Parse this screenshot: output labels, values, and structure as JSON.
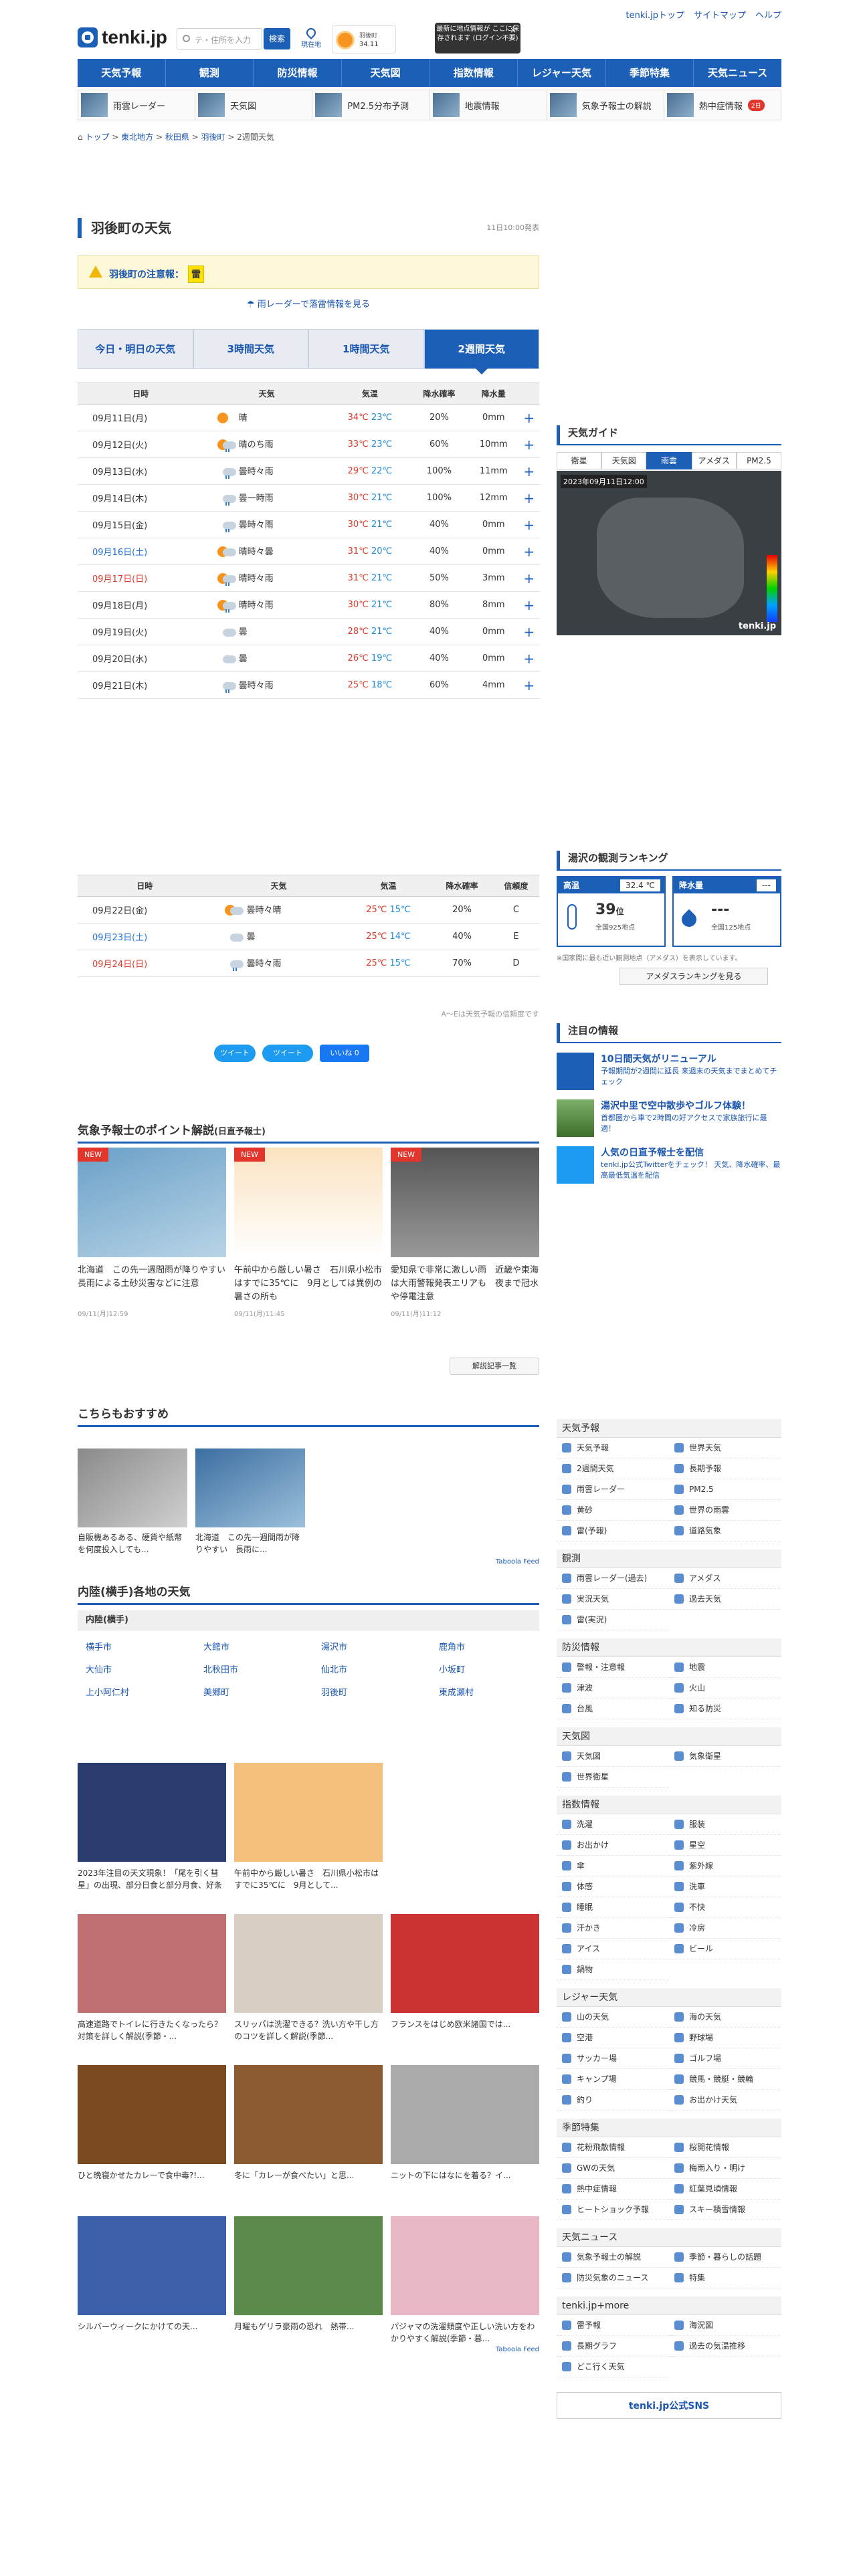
{
  "header": {
    "logo": "tenki.jp",
    "search_placeholder": "テ・住所を入力",
    "search_btn": "検索",
    "loc": "現在地",
    "home_t1": "羽後町",
    "home_t2": "34.11",
    "tooltip": "最新に地点情報が ここに保存されます (ログイン不要)",
    "close": "×",
    "toplinks": [
      "tenki.jpトップ",
      "サイトマップ",
      "ヘルプ"
    ]
  },
  "gnav": [
    "天気予報",
    "観測",
    "防災情報",
    "天気図",
    "指数情報",
    "レジャー天気",
    "季節特集",
    "天気ニュース"
  ],
  "snav": [
    {
      "label": "雨雲レーダー"
    },
    {
      "label": "天気図"
    },
    {
      "label": "PM2.5分布予測"
    },
    {
      "label": "地震情報"
    },
    {
      "label": "気象予報士の解説"
    },
    {
      "label": "熱中症情報",
      "badge": "2日"
    }
  ],
  "breadcrumb": [
    "トップ",
    "東北地方",
    "秋田県",
    "羽後町",
    "2週間天気"
  ],
  "page": {
    "title": "羽後町の天気",
    "updated": "11日10:00発表",
    "warn_label": "羽後町の注意報：",
    "warn_badge": "雷",
    "radar_link": "雨レーダーで落雷情報を見る"
  },
  "tabs": [
    "今日・明日の天気",
    "3時間天気",
    "1時間天気",
    "2週間天気"
  ],
  "table_head": [
    "日時",
    "天気",
    "気温",
    "降水確率",
    "降水量"
  ],
  "rows": [
    {
      "d": "09月11日(月)",
      "w": "晴",
      "hi": "34℃",
      "lo": "23℃",
      "p": "20%",
      "a": "0mm",
      "k": "s"
    },
    {
      "d": "09月12日(火)",
      "w": "晴のち雨",
      "hi": "33℃",
      "lo": "23℃",
      "p": "60%",
      "a": "10mm",
      "k": "sr"
    },
    {
      "d": "09月13日(水)",
      "w": "曇時々雨",
      "hi": "29℃",
      "lo": "22℃",
      "p": "100%",
      "a": "11mm",
      "k": "cr"
    },
    {
      "d": "09月14日(木)",
      "w": "曇一時雨",
      "hi": "30℃",
      "lo": "21℃",
      "p": "100%",
      "a": "12mm",
      "k": "cr"
    },
    {
      "d": "09月15日(金)",
      "w": "曇時々雨",
      "hi": "30℃",
      "lo": "21℃",
      "p": "40%",
      "a": "0mm",
      "k": "cr"
    },
    {
      "d": "09月16日(土)",
      "w": "晴時々曇",
      "hi": "31℃",
      "lo": "20℃",
      "p": "40%",
      "a": "0mm",
      "k": "sc"
    },
    {
      "d": "09月17日(日)",
      "w": "晴時々雨",
      "hi": "31℃",
      "lo": "21℃",
      "p": "50%",
      "a": "3mm",
      "k": "sr"
    },
    {
      "d": "09月18日(月)",
      "w": "晴時々雨",
      "hi": "30℃",
      "lo": "21℃",
      "p": "80%",
      "a": "8mm",
      "k": "sr"
    },
    {
      "d": "09月19日(火)",
      "w": "曇",
      "hi": "28℃",
      "lo": "21℃",
      "p": "40%",
      "a": "0mm",
      "k": "c"
    },
    {
      "d": "09月20日(水)",
      "w": "曇",
      "hi": "26℃",
      "lo": "19℃",
      "p": "40%",
      "a": "0mm",
      "k": "c"
    },
    {
      "d": "09月21日(木)",
      "w": "曇時々雨",
      "hi": "25℃",
      "lo": "18℃",
      "p": "60%",
      "a": "4mm",
      "k": "cr"
    }
  ],
  "table2_head": [
    "日時",
    "天気",
    "気温",
    "降水確率",
    "信頼度"
  ],
  "rows2": [
    {
      "d": "09月22日(金)",
      "w": "曇時々晴",
      "hi": "25℃",
      "lo": "15℃",
      "p": "20%",
      "a": "C",
      "k": "sc"
    },
    {
      "d": "09月23日(土)",
      "w": "曇",
      "hi": "25℃",
      "lo": "14℃",
      "p": "40%",
      "a": "E",
      "k": "c"
    },
    {
      "d": "09月24日(日)",
      "w": "曇時々雨",
      "hi": "25℃",
      "lo": "15℃",
      "p": "70%",
      "a": "D",
      "k": "cr"
    }
  ],
  "note": "A〜Eは天気予報の信頼度です",
  "sns": [
    "ツイート",
    "ツイート",
    "いいね 0"
  ],
  "expert": {
    "title": "気象予報士のポイント解説",
    "sub": "(日直予報士)",
    "new": "NEW",
    "cards": [
      {
        "t": "北海道　この先一週間雨が降りやすい　長雨による土砂災害などに注意",
        "dt": "09/11(月)12:59"
      },
      {
        "t": "午前中から厳しい暑さ　石川県小松市はすでに35℃に　9月としては異例の暑さの所も",
        "dt": "09/11(月)11:45"
      },
      {
        "t": "愛知県で非常に激しい雨　近畿や東海は大雨警報発表エリアも　夜まで冠水や停電注意",
        "dt": "09/11(月)11:12"
      }
    ],
    "more": "解説記事一覧"
  },
  "rec": {
    "title": "こちらもおすすめ",
    "items": [
      "自販機あるある、硬貨や紙幣を何度投入しても...",
      "北海道　この先一週間雨が降りやすい　長雨に..."
    ],
    "feed": "Taboola Feed"
  },
  "area": {
    "title": "内陸(横手)各地の天気",
    "sub": "内陸(横手)",
    "cities": [
      "横手市",
      "大館市",
      "湯沢市",
      "鹿角市",
      "大仙市",
      "北秋田市",
      "仙北市",
      "小坂町",
      "上小阿仁村",
      "美郷町",
      "羽後町",
      "東成瀬村"
    ]
  },
  "ads": [
    "2023年注目の天文現象！「尾を引く彗星」の出現、部分日食と部分月食、好条件の「ふたご座流星...",
    "午前中から厳しい暑さ　石川県小松市はすでに35℃に　9月として...",
    "",
    "高速道路でトイレに行きたくなったら？対策を詳しく解説(季節・...",
    "スリッパは洗濯できる？洗い方や干し方のコツを詳しく解説(季節...",
    "フランスをはじめ欧米諸国では...",
    "ひと晩寝かせたカレーで食中毒?!...",
    "冬に「カレーが食べたい」と思...",
    "ニットの下にはなにを着る？イ...",
    "シルバーウィークにかけての天...",
    "月曜もゲリラ豪雨の恐れ　熱帯...",
    "パジャマの洗濯頻度や正しい洗い方をわかりやすく解説(季節・暮..."
  ],
  "right": {
    "guide": "天気ガイド",
    "gtabs": [
      "衛星",
      "天気図",
      "雨雲",
      "アメダス",
      "PM2.5"
    ],
    "map_ts": "2023年09月11日12:00",
    "brand": "tenki.jp",
    "rank": "湯沢の観測ランキング",
    "temp_label": "高温",
    "temp_val": "32.4 ℃",
    "temp_rank": "39",
    "temp_unit": "位",
    "temp_sub": "全国925地点",
    "rain_label": "降水量",
    "rain_val": "---",
    "rain_rank": "---",
    "rain_sub": "全国125地点",
    "rank_note": "※国家間に最も近い観測地点（アメダス）を表示しています。",
    "rank_btn": "アメダスランキングを見る",
    "notice": "注目の情報",
    "news": [
      {
        "t": "10日間天気がリニューアル",
        "d": "予報期間が2週間に延長 来週末の天気までまとめてチェック"
      },
      {
        "t": "湯沢中里で空中散歩やゴルフ体験！",
        "d": "首都圏から車で2時間の好アクセスで家族旅行に最適！"
      },
      {
        "t": "人気の日直予報士を配信",
        "d": "tenki.jp公式Twitterをチェック！ 天気、降水確率、最高最低気温を配信"
      }
    ],
    "menus": [
      {
        "h": "天気予報",
        "items": [
          "天気予報",
          "世界天気",
          "2週間天気",
          "長期予報",
          "雨雲レーダー",
          "PM2.5",
          "黄砂",
          "世界の雨雲",
          "雷(予報)",
          "道路気象"
        ]
      },
      {
        "h": "観測",
        "items": [
          "雨雲レーダー(過去)",
          "アメダス",
          "実況天気",
          "過去天気",
          "雷(実況)"
        ]
      },
      {
        "h": "防災情報",
        "items": [
          "警報・注意報",
          "地震",
          "津波",
          "火山",
          "台風",
          "知る防災"
        ]
      },
      {
        "h": "天気図",
        "items": [
          "天気図",
          "気象衛星",
          "世界衛星"
        ]
      },
      {
        "h": "指数情報",
        "items": [
          "洗濯",
          "服装",
          "お出かけ",
          "星空",
          "傘",
          "紫外線",
          "体感",
          "洗車",
          "睡眠",
          "不快",
          "汗かき",
          "冷房",
          "アイス",
          "ビール",
          "鍋物"
        ]
      },
      {
        "h": "レジャー天気",
        "items": [
          "山の天気",
          "海の天気",
          "空港",
          "野球場",
          "サッカー場",
          "ゴルフ場",
          "キャンプ場",
          "競馬・競艇・競輪",
          "釣り",
          "お出かけ天気"
        ]
      },
      {
        "h": "季節特集",
        "items": [
          "花粉飛散情報",
          "桜開花情報",
          "GWの天気",
          "梅雨入り・明け",
          "熱中症情報",
          "紅葉見頃情報",
          "ヒートショック予報",
          "スキー積雪情報"
        ]
      },
      {
        "h": "天気ニュース",
        "items": [
          "気象予報士の解説",
          "季節・暮らしの話題",
          "防災気象のニュース",
          "特集"
        ]
      },
      {
        "h": "tenki.jp+more",
        "items": [
          "雷予報",
          "海況図",
          "長期グラフ",
          "過去の気温推移",
          "どこ行く天気"
        ]
      }
    ],
    "sns_box": "tenki.jp公式SNS"
  }
}
